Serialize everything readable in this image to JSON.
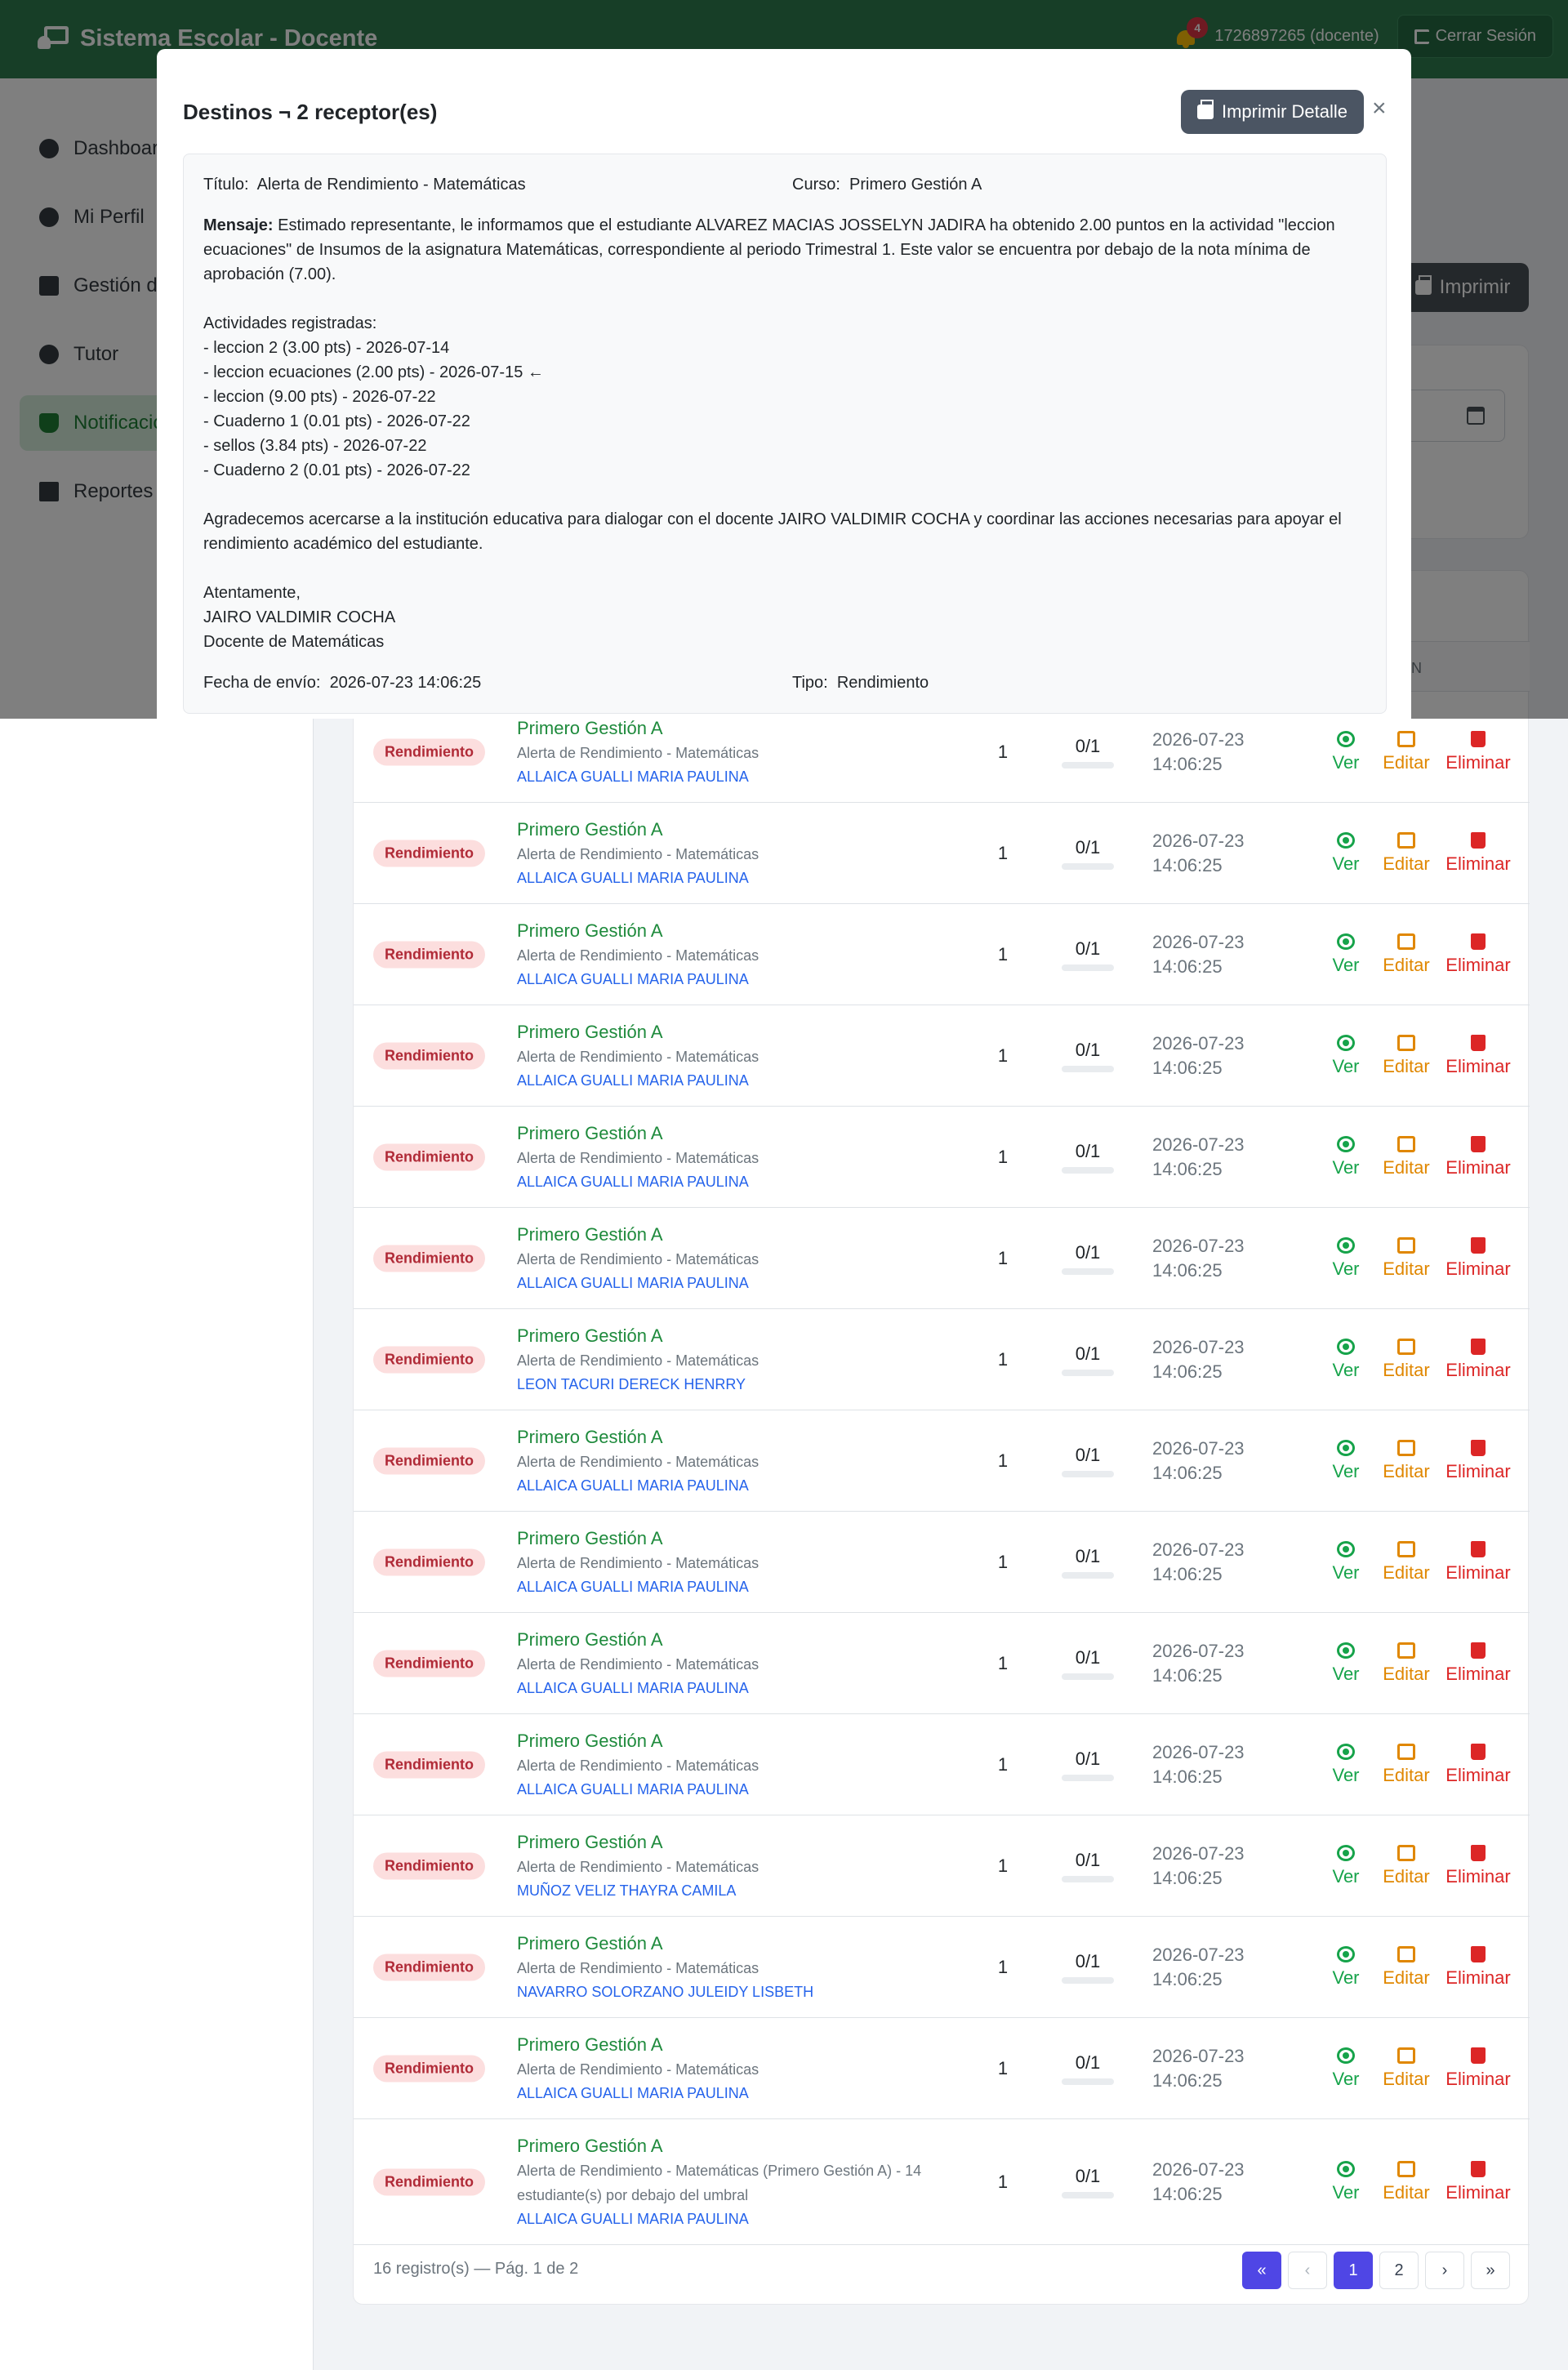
{
  "header": {
    "app_title": "Sistema Escolar - Docente",
    "notification_count": "4",
    "user": "1726897265 (docente)",
    "logout_label": "Cerrar Sesión"
  },
  "sidebar": {
    "items": [
      {
        "label": "Dashboar",
        "icon": "dashboard-icon"
      },
      {
        "label": "Mi Perfil",
        "icon": "user-icon"
      },
      {
        "label": "Gestión de",
        "icon": "clipboard-icon"
      },
      {
        "label": "Tutor",
        "icon": "clock-icon"
      },
      {
        "label": "Notificacio",
        "icon": "bell-icon"
      },
      {
        "label": "Reportes",
        "icon": "file-excel-icon"
      }
    ]
  },
  "main": {
    "print_label": "Imprimir",
    "table_header_actions": "CIÓN"
  },
  "modal": {
    "title": "Destinos ¬ 2 receptor(es)",
    "print_detail_label": "Imprimir Detalle",
    "close_label": "×",
    "titulo_label": "Título:",
    "titulo_value": "Alerta de Rendimiento - Matemáticas",
    "curso_label": "Curso:",
    "curso_value": "Primero Gestión A",
    "mensaje_label": "Mensaje:",
    "mensaje_value": "Estimado representante, le informamos que el estudiante ALVAREZ MACIAS JOSSELYN JADIRA ha obtenido 2.00 puntos en la actividad \"leccion ecuaciones\" de Insumos de la asignatura Matemáticas, correspondiente al periodo Trimestral 1. Este valor se encuentra por debajo de la nota mínima de aprobación (7.00).\n\nActividades registradas:\n  - leccion 2 (3.00 pts) - 2026-07-14\n  - leccion ecuaciones (2.00 pts) - 2026-07-15 ←\n  - leccion (9.00 pts) - 2026-07-22\n  - Cuaderno 1 (0.01 pts) - 2026-07-22\n  - sellos (3.84 pts) - 2026-07-22\n  - Cuaderno 2 (0.01 pts) - 2026-07-22\n\nAgradecemos acercarse a la institución educativa para dialogar con el docente JAIRO VALDIMIR COCHA y coordinar las acciones necesarias para apoyar el rendimiento académico del estudiante.\n\nAtentamente,\nJAIRO VALDIMIR COCHA\nDocente de Matemáticas",
    "fecha_label": "Fecha de envío:",
    "fecha_value": "2026-07-23 14:06:25",
    "tipo_label": "Tipo:",
    "tipo_value": "Rendimiento"
  },
  "table": {
    "actions": {
      "view": "Ver",
      "edit": "Editar",
      "delete": "Eliminar"
    },
    "rows": [
      {
        "type": "Rendimiento",
        "course": "Primero Gestión A",
        "title": "Alerta de Rendimiento - Matemáticas",
        "student": "ALLAICA GUALLI MARIA PAULINA",
        "count": "1",
        "read": "0/1",
        "date": "2026-07-23",
        "time": "14:06:25"
      },
      {
        "type": "Rendimiento",
        "course": "Primero Gestión A",
        "title": "Alerta de Rendimiento - Matemáticas",
        "student": "ALLAICA GUALLI MARIA PAULINA",
        "count": "1",
        "read": "0/1",
        "date": "2026-07-23",
        "time": "14:06:25"
      },
      {
        "type": "Rendimiento",
        "course": "Primero Gestión A",
        "title": "Alerta de Rendimiento - Matemáticas",
        "student": "ALLAICA GUALLI MARIA PAULINA",
        "count": "1",
        "read": "0/1",
        "date": "2026-07-23",
        "time": "14:06:25"
      },
      {
        "type": "Rendimiento",
        "course": "Primero Gestión A",
        "title": "Alerta de Rendimiento - Matemáticas",
        "student": "ALLAICA GUALLI MARIA PAULINA",
        "count": "1",
        "read": "0/1",
        "date": "2026-07-23",
        "time": "14:06:25"
      },
      {
        "type": "Rendimiento",
        "course": "Primero Gestión A",
        "title": "Alerta de Rendimiento - Matemáticas",
        "student": "ALLAICA GUALLI MARIA PAULINA",
        "count": "1",
        "read": "0/1",
        "date": "2026-07-23",
        "time": "14:06:25"
      },
      {
        "type": "Rendimiento",
        "course": "Primero Gestión A",
        "title": "Alerta de Rendimiento - Matemáticas",
        "student": "ALLAICA GUALLI MARIA PAULINA",
        "count": "1",
        "read": "0/1",
        "date": "2026-07-23",
        "time": "14:06:25"
      },
      {
        "type": "Rendimiento",
        "course": "Primero Gestión A",
        "title": "Alerta de Rendimiento - Matemáticas",
        "student": "LEON TACURI DERECK HENRRY",
        "count": "1",
        "read": "0/1",
        "date": "2026-07-23",
        "time": "14:06:25"
      },
      {
        "type": "Rendimiento",
        "course": "Primero Gestión A",
        "title": "Alerta de Rendimiento - Matemáticas",
        "student": "ALLAICA GUALLI MARIA PAULINA",
        "count": "1",
        "read": "0/1",
        "date": "2026-07-23",
        "time": "14:06:25"
      },
      {
        "type": "Rendimiento",
        "course": "Primero Gestión A",
        "title": "Alerta de Rendimiento - Matemáticas",
        "student": "ALLAICA GUALLI MARIA PAULINA",
        "count": "1",
        "read": "0/1",
        "date": "2026-07-23",
        "time": "14:06:25"
      },
      {
        "type": "Rendimiento",
        "course": "Primero Gestión A",
        "title": "Alerta de Rendimiento - Matemáticas",
        "student": "ALLAICA GUALLI MARIA PAULINA",
        "count": "1",
        "read": "0/1",
        "date": "2026-07-23",
        "time": "14:06:25"
      },
      {
        "type": "Rendimiento",
        "course": "Primero Gestión A",
        "title": "Alerta de Rendimiento - Matemáticas",
        "student": "ALLAICA GUALLI MARIA PAULINA",
        "count": "1",
        "read": "0/1",
        "date": "2026-07-23",
        "time": "14:06:25"
      },
      {
        "type": "Rendimiento",
        "course": "Primero Gestión A",
        "title": "Alerta de Rendimiento - Matemáticas",
        "student": "MUÑOZ VELIZ THAYRA CAMILA",
        "count": "1",
        "read": "0/1",
        "date": "2026-07-23",
        "time": "14:06:25"
      },
      {
        "type": "Rendimiento",
        "course": "Primero Gestión A",
        "title": "Alerta de Rendimiento - Matemáticas",
        "student": "NAVARRO SOLORZANO JULEIDY LISBETH",
        "count": "1",
        "read": "0/1",
        "date": "2026-07-23",
        "time": "14:06:25"
      },
      {
        "type": "Rendimiento",
        "course": "Primero Gestión A",
        "title": "Alerta de Rendimiento - Matemáticas",
        "student": "ALLAICA GUALLI MARIA PAULINA",
        "count": "1",
        "read": "0/1",
        "date": "2026-07-23",
        "time": "14:06:25"
      },
      {
        "type": "Rendimiento",
        "course": "Primero Gestión A",
        "title": "Alerta de Rendimiento - Matemáticas (Primero Gestión A) - 14 estudiante(s) por debajo del umbral",
        "student": "ALLAICA GUALLI MARIA PAULINA",
        "count": "1",
        "read": "0/1",
        "date": "2026-07-23",
        "time": "14:06:25"
      }
    ]
  },
  "footer": {
    "records": "16 registro(s) — Pág. 1 de 2",
    "pages": [
      "«",
      "‹",
      "1",
      "2",
      "›",
      "»"
    ]
  }
}
